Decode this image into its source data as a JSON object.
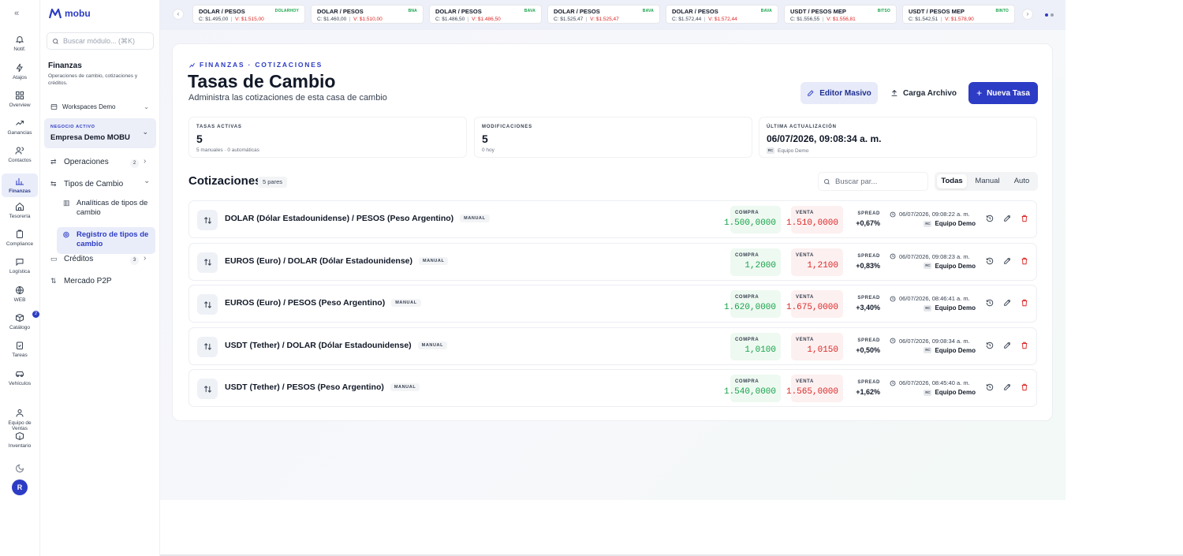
{
  "app": {
    "logo_text": "mobu"
  },
  "rail": {
    "items": [
      {
        "label": "Notif.",
        "icon": "bell-icon"
      },
      {
        "label": "Atajos",
        "icon": "bolt-icon"
      },
      {
        "label": "Overview",
        "icon": "grid-icon"
      },
      {
        "label": "Ganancias",
        "icon": "trending-up-icon"
      },
      {
        "label": "Contactos",
        "icon": "users-icon"
      },
      {
        "label": "Finanzas",
        "icon": "bar-chart-icon",
        "active": true
      },
      {
        "label": "Tesorería",
        "icon": "home-icon"
      },
      {
        "label": "Compliance",
        "icon": "clipboard-icon"
      },
      {
        "label": "Logística",
        "icon": "chat-icon"
      },
      {
        "label": "WEB",
        "icon": "globe-icon"
      },
      {
        "label": "Catálogo",
        "icon": "package-icon",
        "badge": "2"
      },
      {
        "label": "Tareas",
        "icon": "clipboard-check-icon"
      },
      {
        "label": "Vehículos",
        "icon": "car-icon"
      },
      {
        "label": "Equipo de Ventas",
        "icon": "team-icon"
      },
      {
        "label": "Inventario",
        "icon": "box-icon"
      }
    ],
    "avatar": "R"
  },
  "sidebar": {
    "search_placeholder": "Buscar módulo... (⌘K)",
    "section_title": "Finanzas",
    "section_desc": "Operaciones de cambio, cotizaciones y créditos.",
    "workspace": "Workspaces Demo",
    "business_label": "NEGOCIO ACTIVO",
    "business_name": "Empresa Demo MOBU",
    "menu": [
      {
        "label": "Operaciones",
        "badge": "2"
      },
      {
        "label": "Tipos de Cambio"
      },
      {
        "label": "Analíticas de tipos de cambio"
      },
      {
        "label": "Registro de tipos de cambio"
      },
      {
        "label": "Créditos",
        "badge": "3"
      },
      {
        "label": "Mercado P2P"
      }
    ]
  },
  "ticker": [
    {
      "pair": "DOLAR / PESOS",
      "source": "DOLARHOY",
      "buy": "C: $1.495,00",
      "sell": "V: $1.515,00"
    },
    {
      "pair": "DOLAR / PESOS",
      "source": "BNA",
      "buy": "C: $1.460,00",
      "sell": "V: $1.510,00"
    },
    {
      "pair": "DOLAR / PESOS",
      "source": "BAVA",
      "buy": "C: $1.486,50",
      "sell": "V: $1.486,50"
    },
    {
      "pair": "DOLAR / PESOS",
      "source": "BAVA",
      "buy": "C: $1.525,47",
      "sell": "V: $1.525,47"
    },
    {
      "pair": "DOLAR / PESOS",
      "source": "BAVA",
      "buy": "C: $1.572,44",
      "sell": "V: $1.572,44"
    },
    {
      "pair": "USDT / PESOS MEP",
      "source": "BITSO",
      "buy": "C: $1.556,55",
      "sell": "V: $1.556,81"
    },
    {
      "pair": "USDT / PESOS MEP",
      "source": "BINTO",
      "buy": "C: $1.542,51",
      "sell": "V: $1.578,90"
    }
  ],
  "page": {
    "breadcrumb": "FINANZAS · COTIZACIONES",
    "title": "Tasas de Cambio",
    "subtitle": "Administra las cotizaciones de esta casa de cambio",
    "btn_bulk": "Editor Masivo",
    "btn_upload": "Carga Archivo",
    "btn_new": "Nueva Tasa"
  },
  "stats": {
    "active": {
      "label": "TASAS ACTIVAS",
      "value": "5",
      "sub": "5 manuales · 0 automáticas"
    },
    "mods": {
      "label": "MODIFICACIONES",
      "value": "5",
      "sub": "0 hoy"
    },
    "last": {
      "label": "ÚLTIMA ACTUALIZACIÓN",
      "value": "06/07/2026, 09:08:34 a. m.",
      "sub": "Equipo Demo"
    }
  },
  "quotes": {
    "title": "Cotizaciones",
    "count": "5 pares",
    "search_placeholder": "Buscar par...",
    "filters": [
      "Todas",
      "Manual",
      "Auto"
    ],
    "buy_label": "COMPRA",
    "sell_label": "VENTA",
    "spread_label": "SPREAD",
    "rows": [
      {
        "pair": "DOLAR (Dólar Estadounidense) / PESOS (Peso Argentino)",
        "mode": "MANUAL",
        "buy": "1.500,0000",
        "sell": "1.510,0000",
        "spread": "+0,67%",
        "time": "06/07/2026, 09:08:22 a. m.",
        "user": "Equipo Demo"
      },
      {
        "pair": "EUROS (Euro) / DOLAR (Dólar Estadounidense)",
        "mode": "MANUAL",
        "buy": "1,2000",
        "sell": "1,2100",
        "spread": "+0,83%",
        "time": "06/07/2026, 09:08:23 a. m.",
        "user": "Equipo Demo"
      },
      {
        "pair": "EUROS (Euro) / PESOS (Peso Argentino)",
        "mode": "MANUAL",
        "buy": "1.620,0000",
        "sell": "1.675,0000",
        "spread": "+3,40%",
        "time": "06/07/2026, 08:46:41 a. m.",
        "user": "Equipo Demo"
      },
      {
        "pair": "USDT (Tether) / DOLAR (Dólar Estadounidense)",
        "mode": "MANUAL",
        "buy": "1,0100",
        "sell": "1,0150",
        "spread": "+0,50%",
        "time": "06/07/2026, 09:08:34 a. m.",
        "user": "Equipo Demo"
      },
      {
        "pair": "USDT (Tether) / PESOS (Peso Argentino)",
        "mode": "MANUAL",
        "buy": "1.540,0000",
        "sell": "1.565,0000",
        "spread": "+1,62%",
        "time": "06/07/2026, 08:45:40 a. m.",
        "user": "Equipo Demo"
      }
    ]
  },
  "colors": {
    "brand": "#2d3cc4",
    "buy": "#16a34a",
    "sell": "#dc2626"
  }
}
